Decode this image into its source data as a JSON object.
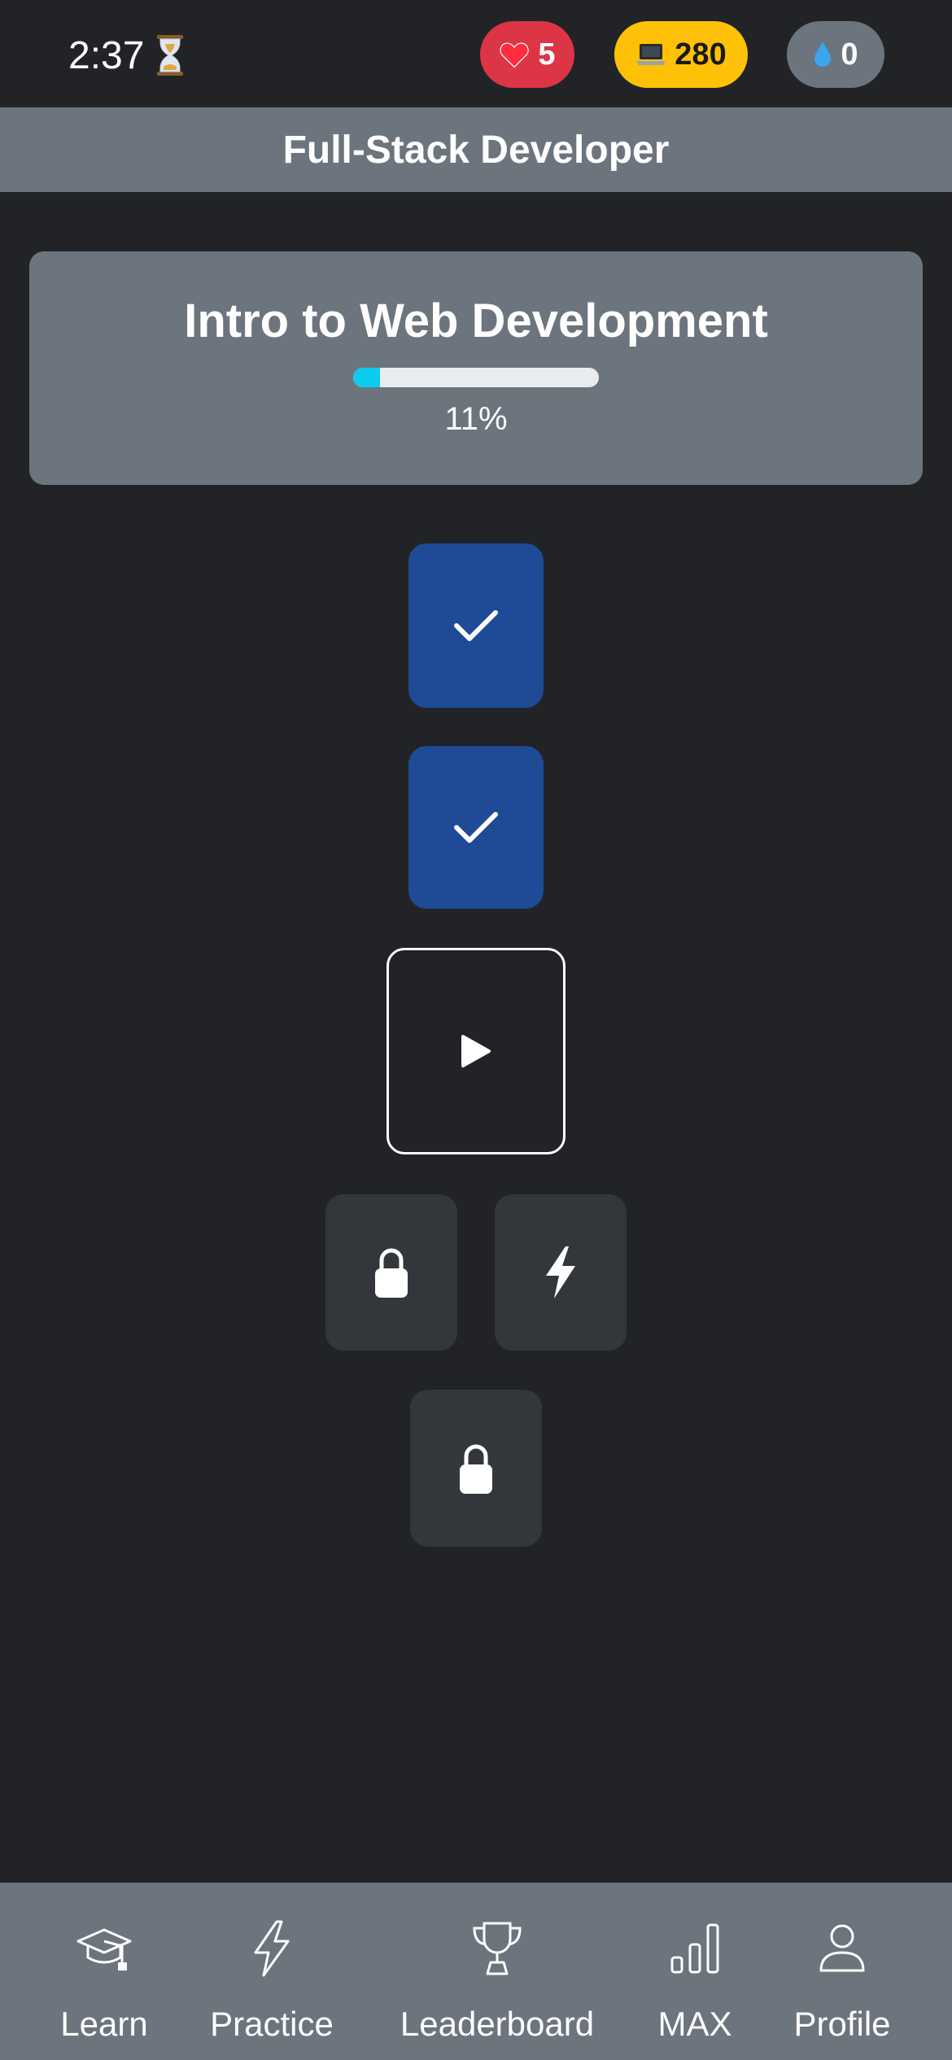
{
  "status": {
    "time": "2:37",
    "hearts": "5",
    "gems": "280",
    "drops": "0"
  },
  "header": {
    "title": "Full-Stack Developer"
  },
  "unit": {
    "title": "Intro to Web Development",
    "progress_percent": 11,
    "progress_label": "11%"
  },
  "lessons": [
    {
      "state": "completed",
      "icon": "checkmark-icon"
    },
    {
      "state": "completed",
      "icon": "checkmark-icon"
    },
    {
      "state": "current",
      "icon": "play-icon"
    },
    {
      "state": "locked",
      "icon": "lock-icon"
    },
    {
      "state": "locked",
      "icon": "lightning-icon"
    },
    {
      "state": "locked",
      "icon": "lock-icon"
    }
  ],
  "colors": {
    "background": "#212326",
    "header": "#6c757d",
    "completed": "#1e4a96",
    "locked": "#33373b",
    "progress": "#0dcaf0",
    "hearts": "#dc3545",
    "gems": "#ffc107"
  },
  "nav": {
    "items": [
      {
        "label": "Learn",
        "icon": "graduation-cap-icon"
      },
      {
        "label": "Practice",
        "icon": "lightning-icon"
      },
      {
        "label": "Leaderboard",
        "icon": "trophy-icon"
      },
      {
        "label": "MAX",
        "icon": "bar-chart-icon"
      },
      {
        "label": "Profile",
        "icon": "person-icon"
      }
    ]
  }
}
